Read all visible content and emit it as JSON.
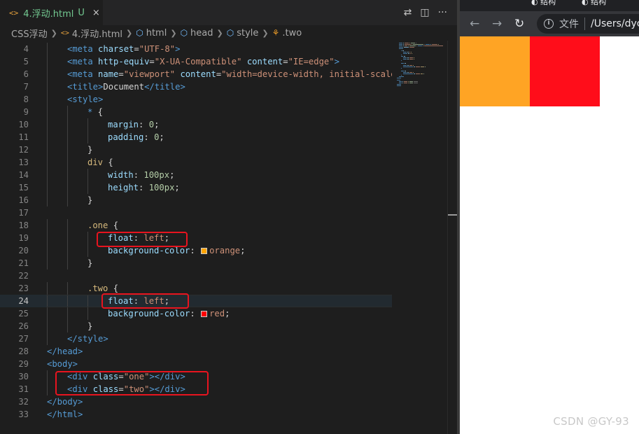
{
  "editor": {
    "tab": {
      "icon": "html-file-icon",
      "name": "4.浮动.html",
      "status": "U",
      "close": "×"
    },
    "breadcrumb": [
      "CSS浮动",
      "4.浮动.html",
      "html",
      "head",
      "style",
      ".two"
    ],
    "current_line": 24,
    "lines": [
      {
        "n": "4",
        "indent": 1,
        "tokens": [
          [
            "tag",
            "<meta"
          ],
          [
            "p",
            " "
          ],
          [
            "attr",
            "charset"
          ],
          [
            "p",
            "="
          ],
          [
            "str",
            "\"UTF-8\""
          ],
          [
            "tag",
            ">"
          ]
        ]
      },
      {
        "n": "5",
        "indent": 1,
        "tokens": [
          [
            "tag",
            "<meta"
          ],
          [
            "p",
            " "
          ],
          [
            "attr",
            "http-equiv"
          ],
          [
            "p",
            "="
          ],
          [
            "str",
            "\"X-UA-Compatible\""
          ],
          [
            "p",
            " "
          ],
          [
            "attr",
            "content"
          ],
          [
            "p",
            "="
          ],
          [
            "str",
            "\"IE=edge\""
          ],
          [
            "tag",
            ">"
          ]
        ]
      },
      {
        "n": "6",
        "indent": 1,
        "tokens": [
          [
            "tag",
            "<meta"
          ],
          [
            "p",
            " "
          ],
          [
            "attr",
            "name"
          ],
          [
            "p",
            "="
          ],
          [
            "str",
            "\"viewport\""
          ],
          [
            "p",
            " "
          ],
          [
            "attr",
            "content"
          ],
          [
            "p",
            "="
          ],
          [
            "str",
            "\"width=device-width, initial-scale="
          ]
        ]
      },
      {
        "n": "7",
        "indent": 1,
        "tokens": [
          [
            "tag",
            "<title>"
          ],
          [
            "txt",
            "Document"
          ],
          [
            "tag",
            "</title>"
          ]
        ]
      },
      {
        "n": "8",
        "indent": 1,
        "tokens": [
          [
            "tag",
            "<style>"
          ]
        ]
      },
      {
        "n": "9",
        "indent": 2,
        "tokens": [
          [
            "kw",
            "*"
          ],
          [
            "p",
            " {"
          ]
        ]
      },
      {
        "n": "10",
        "indent": 3,
        "tokens": [
          [
            "prop",
            "margin"
          ],
          [
            "p",
            ": "
          ],
          [
            "num",
            "0"
          ],
          [
            "p",
            ";"
          ]
        ]
      },
      {
        "n": "11",
        "indent": 3,
        "tokens": [
          [
            "prop",
            "padding"
          ],
          [
            "p",
            ": "
          ],
          [
            "num",
            "0"
          ],
          [
            "p",
            ";"
          ]
        ]
      },
      {
        "n": "12",
        "indent": 2,
        "tokens": [
          [
            "p",
            "}"
          ]
        ]
      },
      {
        "n": "13",
        "indent": 2,
        "tokens": [
          [
            "sel",
            "div"
          ],
          [
            "p",
            " {"
          ]
        ]
      },
      {
        "n": "14",
        "indent": 3,
        "tokens": [
          [
            "prop",
            "width"
          ],
          [
            "p",
            ": "
          ],
          [
            "num",
            "100px"
          ],
          [
            "p",
            ";"
          ]
        ]
      },
      {
        "n": "15",
        "indent": 3,
        "tokens": [
          [
            "prop",
            "height"
          ],
          [
            "p",
            ": "
          ],
          [
            "num",
            "100px"
          ],
          [
            "p",
            ";"
          ]
        ]
      },
      {
        "n": "16",
        "indent": 2,
        "tokens": [
          [
            "p",
            "}"
          ]
        ]
      },
      {
        "n": "17",
        "indent": 0,
        "tokens": []
      },
      {
        "n": "18",
        "indent": 2,
        "tokens": [
          [
            "sel",
            ".one"
          ],
          [
            "p",
            " {"
          ]
        ]
      },
      {
        "n": "19",
        "indent": 3,
        "tokens": [
          [
            "prop",
            "float"
          ],
          [
            "p",
            ": "
          ],
          [
            "str",
            "left"
          ],
          [
            "p",
            ";"
          ]
        ]
      },
      {
        "n": "20",
        "indent": 3,
        "tokens": [
          [
            "prop",
            "background-color"
          ],
          [
            "p",
            ": "
          ],
          [
            "swatch",
            "#ffa500"
          ],
          [
            "str",
            "orange"
          ],
          [
            "p",
            ";"
          ]
        ]
      },
      {
        "n": "21",
        "indent": 2,
        "tokens": [
          [
            "p",
            "}"
          ]
        ]
      },
      {
        "n": "22",
        "indent": 0,
        "tokens": []
      },
      {
        "n": "23",
        "indent": 2,
        "tokens": [
          [
            "sel",
            ".two"
          ],
          [
            "p",
            " {"
          ]
        ]
      },
      {
        "n": "24",
        "indent": 3,
        "tokens": [
          [
            "prop",
            "float"
          ],
          [
            "p",
            ": "
          ],
          [
            "str",
            "left"
          ],
          [
            "p",
            ";"
          ]
        ]
      },
      {
        "n": "25",
        "indent": 3,
        "tokens": [
          [
            "prop",
            "background-color"
          ],
          [
            "p",
            ": "
          ],
          [
            "swatch",
            "#ff0000"
          ],
          [
            "str",
            "red"
          ],
          [
            "p",
            ";"
          ]
        ]
      },
      {
        "n": "26",
        "indent": 2,
        "tokens": [
          [
            "p",
            "}"
          ]
        ]
      },
      {
        "n": "27",
        "indent": 1,
        "tokens": [
          [
            "tag",
            "</style>"
          ]
        ]
      },
      {
        "n": "28",
        "indent": 0,
        "tokens": [
          [
            "tag",
            "</head>"
          ]
        ]
      },
      {
        "n": "29",
        "indent": 0,
        "tokens": [
          [
            "tag",
            "<body>"
          ]
        ]
      },
      {
        "n": "30",
        "indent": 1,
        "tokens": [
          [
            "tag",
            "<div"
          ],
          [
            "p",
            " "
          ],
          [
            "attr",
            "class"
          ],
          [
            "p",
            "="
          ],
          [
            "str",
            "\"one\""
          ],
          [
            "tag",
            "></div>"
          ]
        ]
      },
      {
        "n": "31",
        "indent": 1,
        "tokens": [
          [
            "tag",
            "<div"
          ],
          [
            "p",
            " "
          ],
          [
            "attr",
            "class"
          ],
          [
            "p",
            "="
          ],
          [
            "str",
            "\"two\""
          ],
          [
            "tag",
            "></div>"
          ]
        ]
      },
      {
        "n": "32",
        "indent": 0,
        "tokens": [
          [
            "tag",
            "</body>"
          ]
        ]
      },
      {
        "n": "33",
        "indent": 0,
        "tokens": [
          [
            "tag",
            "</html>"
          ]
        ]
      }
    ]
  },
  "browser": {
    "tabs": [
      "结构",
      "结构"
    ],
    "address_label": "文件",
    "address_url": "/Users/dyc",
    "boxes": [
      {
        "name": "one",
        "color": "#ffa424"
      },
      {
        "name": "two",
        "color": "#ff0d1a"
      }
    ]
  },
  "watermark": "CSDN @GY-93",
  "colors": {
    "editor_bg": "#1e1e1e",
    "highlight_box": "#e8141f"
  }
}
